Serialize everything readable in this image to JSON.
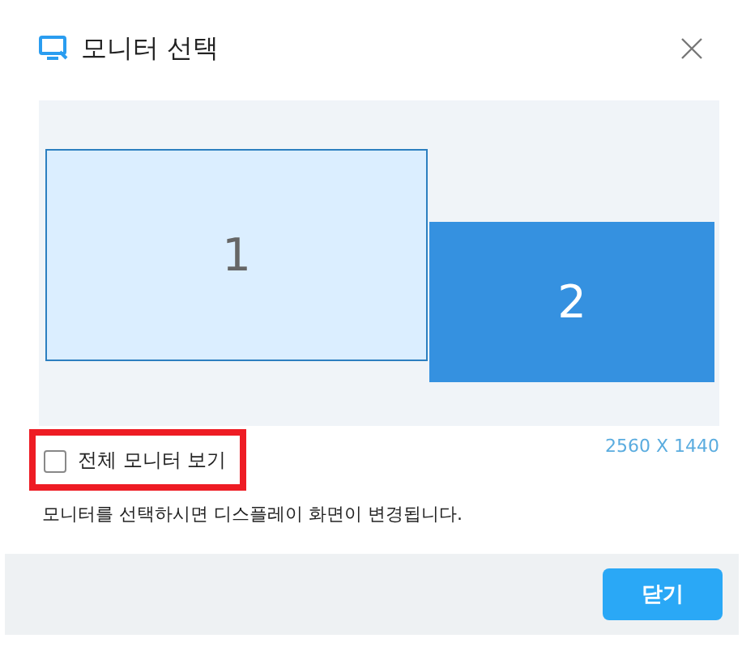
{
  "dialog": {
    "title": "모니터 선택"
  },
  "monitors": [
    {
      "label": "1",
      "selected": false
    },
    {
      "label": "2",
      "selected": true
    }
  ],
  "resolution": "2560 X 1440",
  "show_all": {
    "label": "전체 모니터 보기",
    "checked": false,
    "highlighted": true
  },
  "description": "모니터를 선택하시면 디스플레이 화면이 변경됩니다.",
  "buttons": [
    "닫기"
  ]
}
